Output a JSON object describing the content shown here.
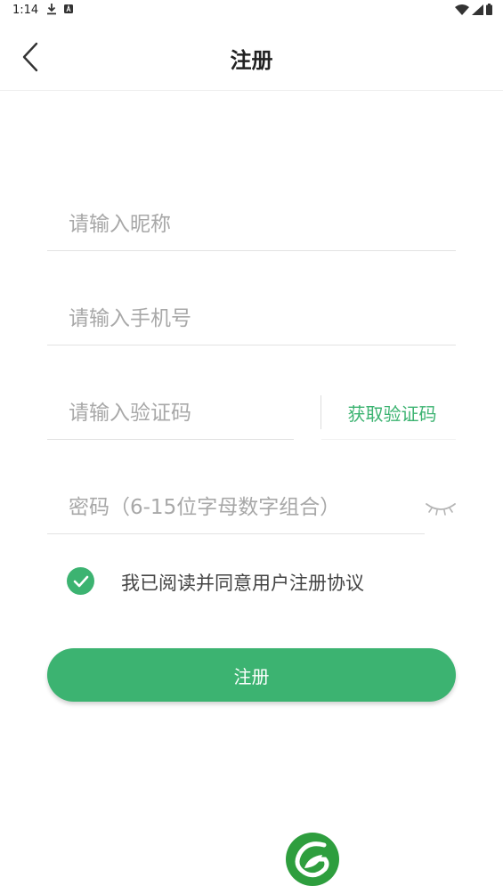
{
  "status_bar": {
    "time": "1:14",
    "icons": [
      "download-icon",
      "a-icon",
      "wifi-icon",
      "signal-icon",
      "battery-icon"
    ]
  },
  "header": {
    "back_icon": "chevron-left-icon",
    "title": "注册"
  },
  "form": {
    "nickname_placeholder": "请输入昵称",
    "phone_placeholder": "请输入手机号",
    "code_placeholder": "请输入验证码",
    "get_code_label": "获取验证码",
    "password_placeholder": "密码（6-15位字母数字组合）",
    "password_toggle_icon": "eye-closed-icon"
  },
  "agreement": {
    "checked": true,
    "label": "我已阅读并同意用户注册协议"
  },
  "register_button_label": "注册",
  "colors": {
    "accent": "#3cb371",
    "placeholder": "#a8a8a8",
    "divider": "#e3e3e3"
  },
  "logo_icon": "leaf-logo-icon"
}
